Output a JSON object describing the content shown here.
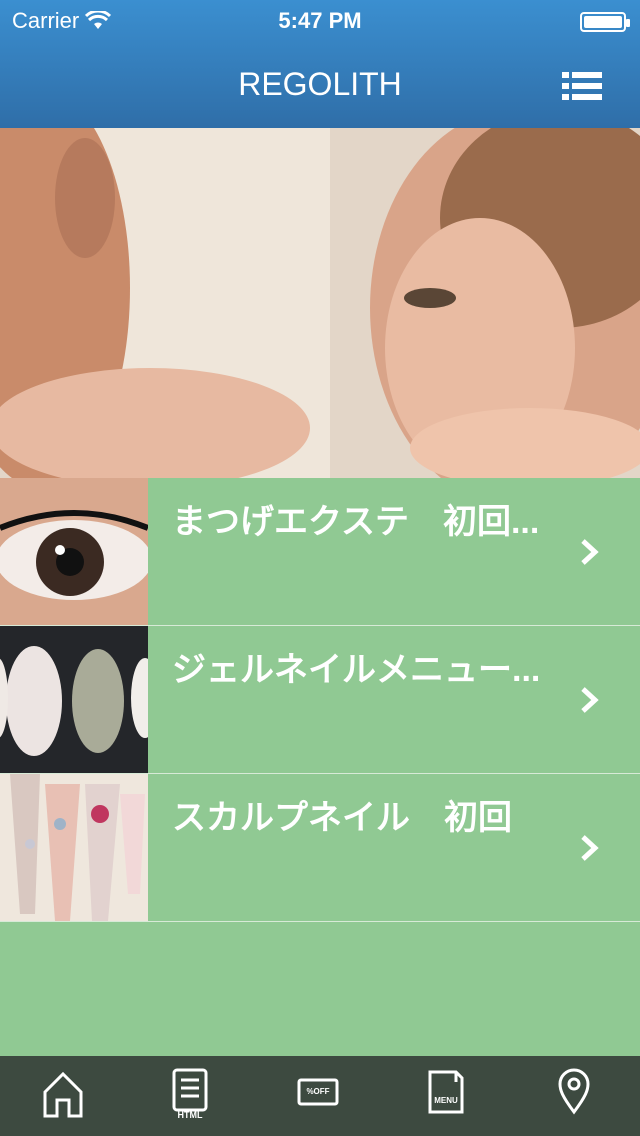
{
  "status_bar": {
    "carrier": "Carrier",
    "time": "5:47 PM"
  },
  "nav": {
    "title": "REGOLITH"
  },
  "list": {
    "items": [
      {
        "label": "まつげエクステ　初回..."
      },
      {
        "label": "ジェルネイルメニュー..."
      },
      {
        "label": "スカルプネイル　初回"
      }
    ]
  },
  "tabbar": {
    "html_label": "HTML",
    "coupon_label": "%OFF",
    "menu_label": "MENU"
  }
}
